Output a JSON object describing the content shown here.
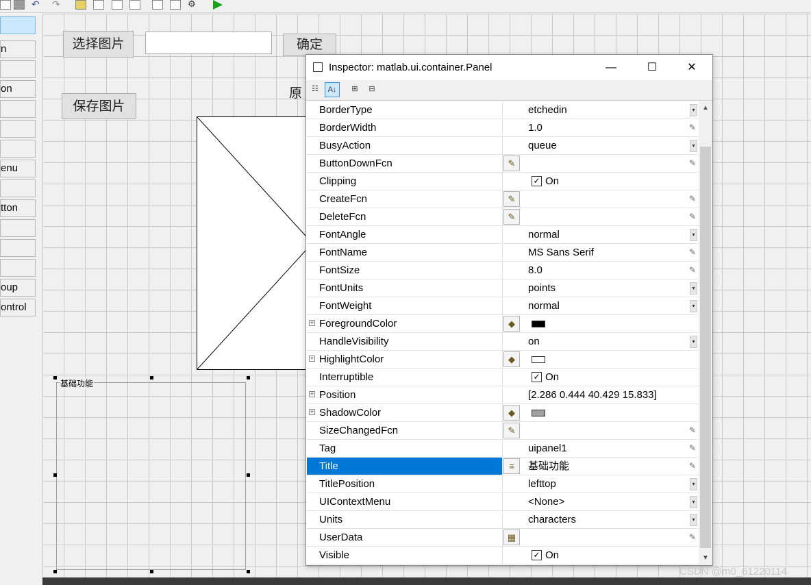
{
  "palette": {
    "items": [
      {
        "label": "",
        "selected": true
      },
      {
        "label": "n"
      },
      {
        "label": ""
      },
      {
        "label": "on"
      },
      {
        "label": ""
      },
      {
        "label": ""
      },
      {
        "label": ""
      },
      {
        "label": "enu"
      },
      {
        "label": ""
      },
      {
        "label": "tton"
      },
      {
        "label": ""
      },
      {
        "label": ""
      },
      {
        "label": ""
      },
      {
        "label": "oup"
      },
      {
        "label": "ontrol"
      }
    ]
  },
  "layout": {
    "select_image_button": "选择图片",
    "confirm_button": "确定",
    "save_image_button": "保存图片",
    "original_label": "原",
    "panel_title": "基础功能",
    "path_edit_value": ""
  },
  "inspector": {
    "title": "Inspector:  matlab.ui.container.Panel",
    "minimize": "—",
    "maximize": "☐",
    "close": "✕",
    "properties": [
      {
        "name": "BorderType",
        "value": "etchedin",
        "control": "dropdown"
      },
      {
        "name": "BorderWidth",
        "value": "1.0",
        "control": "edit"
      },
      {
        "name": "BusyAction",
        "value": "queue",
        "control": "dropdown"
      },
      {
        "name": "ButtonDownFcn",
        "value": "",
        "control": "edit",
        "button": "fcn"
      },
      {
        "name": "Clipping",
        "value": "On",
        "control": "checkbox"
      },
      {
        "name": "CreateFcn",
        "value": "",
        "control": "edit",
        "button": "fcn"
      },
      {
        "name": "DeleteFcn",
        "value": "",
        "control": "edit",
        "button": "fcn"
      },
      {
        "name": "FontAngle",
        "value": "normal",
        "control": "dropdown"
      },
      {
        "name": "FontName",
        "value": "MS Sans Serif",
        "control": "edit"
      },
      {
        "name": "FontSize",
        "value": "8.0",
        "control": "edit"
      },
      {
        "name": "FontUnits",
        "value": "points",
        "control": "dropdown"
      },
      {
        "name": "FontWeight",
        "value": "normal",
        "control": "dropdown"
      },
      {
        "name": "ForegroundColor",
        "value": "",
        "control": "color",
        "button": "color",
        "expandable": true,
        "swatch": "#000000"
      },
      {
        "name": "HandleVisibility",
        "value": "on",
        "control": "dropdown"
      },
      {
        "name": "HighlightColor",
        "value": "",
        "control": "color",
        "button": "color",
        "expandable": true,
        "swatch": "#ffffff"
      },
      {
        "name": "Interruptible",
        "value": "On",
        "control": "checkbox"
      },
      {
        "name": "Position",
        "value": "[2.286 0.444 40.429 15.833]",
        "control": "none",
        "expandable": true
      },
      {
        "name": "ShadowColor",
        "value": "",
        "control": "color",
        "button": "color",
        "expandable": true,
        "swatch": "#a0a0a0"
      },
      {
        "name": "SizeChangedFcn",
        "value": "",
        "control": "edit",
        "button": "fcn"
      },
      {
        "name": "Tag",
        "value": "uipanel1",
        "control": "edit"
      },
      {
        "name": "Title",
        "value": "基础功能",
        "control": "edit",
        "button": "text",
        "selected": true
      },
      {
        "name": "TitlePosition",
        "value": "lefttop",
        "control": "dropdown"
      },
      {
        "name": "UIContextMenu",
        "value": "<None>",
        "control": "dropdown"
      },
      {
        "name": "Units",
        "value": "characters",
        "control": "dropdown"
      },
      {
        "name": "UserData",
        "value": "",
        "control": "edit",
        "button": "grid"
      },
      {
        "name": "Visible",
        "value": "On",
        "control": "checkbox"
      }
    ]
  },
  "watermark": "CSDN @m0_61220114"
}
